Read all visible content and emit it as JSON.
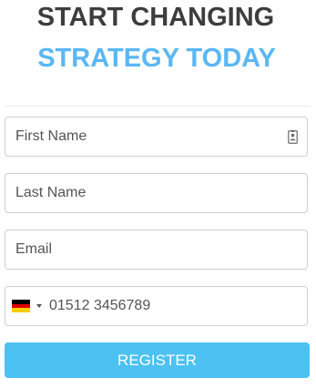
{
  "heading": {
    "line1": "START CHANGING",
    "line2": "STRATEGY TODAY"
  },
  "colors": {
    "heading_dark": "#3d3d3d",
    "heading_accent": "#5ab7f4",
    "button": "#4cc1f2",
    "field_border": "#cfcfcf"
  },
  "form": {
    "first_name": {
      "placeholder": "First Name",
      "icon": "contact-card-icon"
    },
    "last_name": {
      "placeholder": "Last Name"
    },
    "email": {
      "placeholder": "Email"
    },
    "phone": {
      "placeholder": "01512 3456789",
      "country_flag": "germany-flag-icon",
      "country_colors": [
        "#000000",
        "#dd0000",
        "#ffce00"
      ]
    },
    "register_label": "REGISTER"
  }
}
